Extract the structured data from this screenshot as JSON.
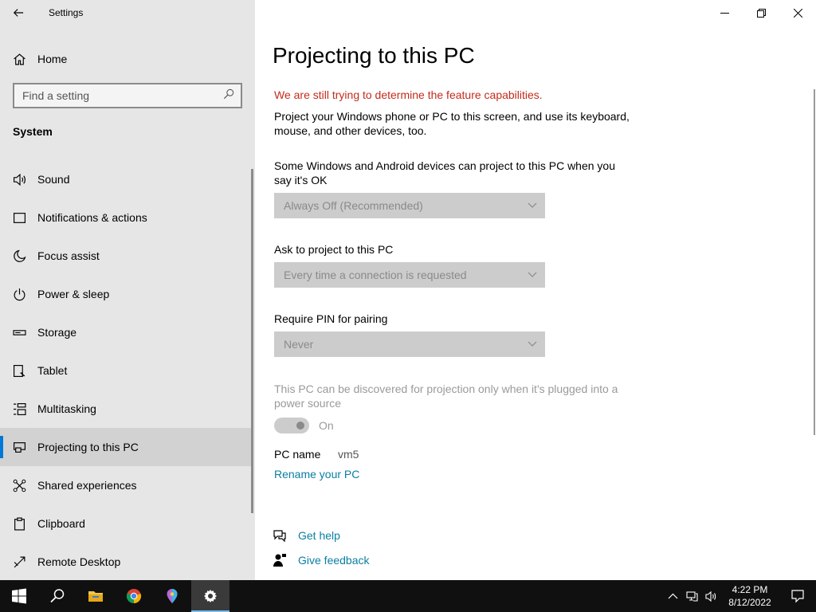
{
  "window": {
    "title": "Settings"
  },
  "sidebar": {
    "home_label": "Home",
    "search_placeholder": "Find a setting",
    "section_title": "System",
    "items": [
      {
        "label": "Sound",
        "icon": "speaker-icon"
      },
      {
        "label": "Notifications & actions",
        "icon": "notification-icon"
      },
      {
        "label": "Focus assist",
        "icon": "moon-icon"
      },
      {
        "label": "Power & sleep",
        "icon": "power-icon"
      },
      {
        "label": "Storage",
        "icon": "storage-icon"
      },
      {
        "label": "Tablet",
        "icon": "tablet-icon"
      },
      {
        "label": "Multitasking",
        "icon": "multitasking-icon"
      },
      {
        "label": "Projecting to this PC",
        "icon": "projecting-icon",
        "selected": true
      },
      {
        "label": "Shared experiences",
        "icon": "shared-experiences-icon"
      },
      {
        "label": "Clipboard",
        "icon": "clipboard-icon"
      },
      {
        "label": "Remote Desktop",
        "icon": "remote-desktop-icon"
      }
    ]
  },
  "main": {
    "page_title": "Projecting to this PC",
    "warning": "We are still trying to determine the feature capabilities.",
    "description": "Project your Windows phone or PC to this screen, and use its keyboard, mouse, and other devices, too.",
    "setting1": {
      "label": "Some Windows and Android devices can project to this PC when you say it's OK",
      "value": "Always Off (Recommended)"
    },
    "setting2": {
      "label": "Ask to project to this PC",
      "value": "Every time a connection is requested"
    },
    "setting3": {
      "label": "Require PIN for pairing",
      "value": "Never"
    },
    "power_source_text": "This PC can be discovered for projection only when it's plugged into a power source",
    "toggle_label": "On",
    "pc_name_label": "PC name",
    "pc_name_value": "vm5",
    "rename_link": "Rename your PC",
    "get_help": "Get help",
    "give_feedback": "Give feedback"
  },
  "taskbar": {
    "time": "4:22 PM",
    "date": "8/12/2022"
  },
  "colors": {
    "accent": "#0078d7",
    "link": "#0a7ea4",
    "warning": "#c42b1c"
  }
}
